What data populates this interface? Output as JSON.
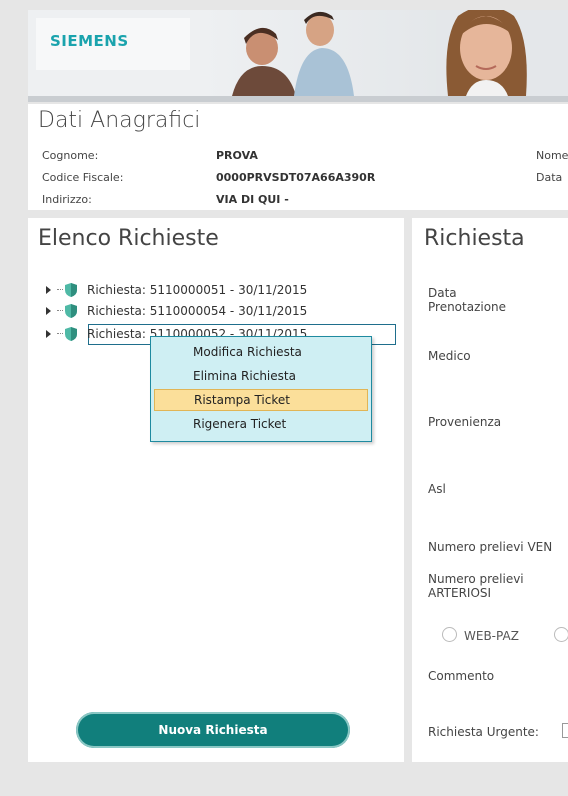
{
  "header": {
    "logo": "SIEMENS"
  },
  "anagrafici": {
    "title": "Dati Anagrafici",
    "cognome_label": "Cognome:",
    "cognome_value": "PROVA",
    "cf_label": "Codice Fiscale:",
    "cf_value": "0000PRVSDT07A66A390R",
    "indirizzo_label": "Indirizzo:",
    "indirizzo_value": "VIA DI QUI -",
    "nome_label": "Nome",
    "data_label": "Data"
  },
  "elenco": {
    "title": "Elenco Richieste",
    "items": [
      "Richiesta: 5110000051 - 30/11/2015",
      "Richiesta: 5110000054 - 30/11/2015",
      "Richiesta: 5110000052 - 30/11/2015"
    ],
    "new_button": "Nuova Richiesta"
  },
  "context_menu": {
    "items": [
      "Modifica Richiesta",
      "Elimina Richiesta",
      "Ristampa Ticket",
      "Rigenera Ticket"
    ],
    "highlighted": "Ristampa Ticket"
  },
  "richiesta": {
    "title": "Richiesta",
    "data_prenotazione": "Data\nPrenotazione",
    "medico": "Medico",
    "provenienza": "Provenienza",
    "asl": "Asl",
    "num_venosi": "Numero prelievi VEN",
    "num_arteriosi": "Numero prelievi\nARTERIOSI",
    "web_paz": "WEB-PAZ",
    "commento": "Commento",
    "urgente": "Richiesta Urgente:"
  },
  "colors": {
    "accent": "#117f7c",
    "logo": "#1aa3ad",
    "menu_bg": "#cfeff3",
    "menu_highlight": "#fbdf9a"
  }
}
